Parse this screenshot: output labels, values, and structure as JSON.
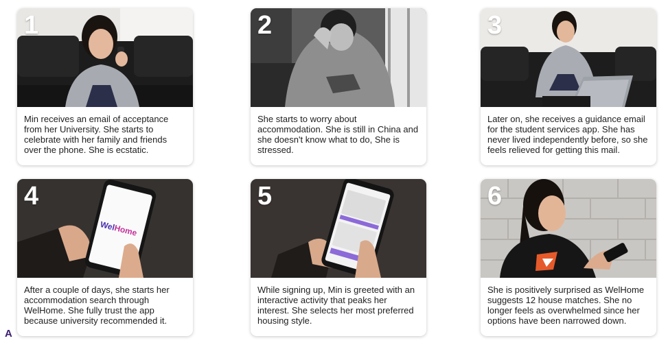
{
  "steps": [
    {
      "number": "1",
      "caption": "Min receives an email of acceptance from her University. She starts to celebrate with her family and friends over the phone. She is ecstatic."
    },
    {
      "number": "2",
      "caption": "She starts to worry about accommodation. She is still in China and she doesn't know what to do, She is stressed."
    },
    {
      "number": "3",
      "caption": "Later on, she receives a guidance email for the student services app. She has never lived independently before, so she feels relieved for getting this mail."
    },
    {
      "number": "4",
      "caption": "After a couple of days, she starts her accommodation search through WelHome. She fully trust the app because university recommended it.",
      "app_logo_part1": "Wel",
      "app_logo_part2": "Home"
    },
    {
      "number": "5",
      "caption": "While signing up, Min is greeted with an interactive activity that peaks her interest. She selects her most preferred housing style."
    },
    {
      "number": "6",
      "caption": "She is positively surprised as WelHome suggests 12 house matches. She no longer feels as overwhelmed since her options have been narrowed down."
    }
  ],
  "corner_label": "A",
  "colors": {
    "label": "#3a1d6e",
    "logo_primary": "#4b2fb0",
    "logo_secondary": "#c3319b",
    "app_accent": "#8c6ad8"
  }
}
